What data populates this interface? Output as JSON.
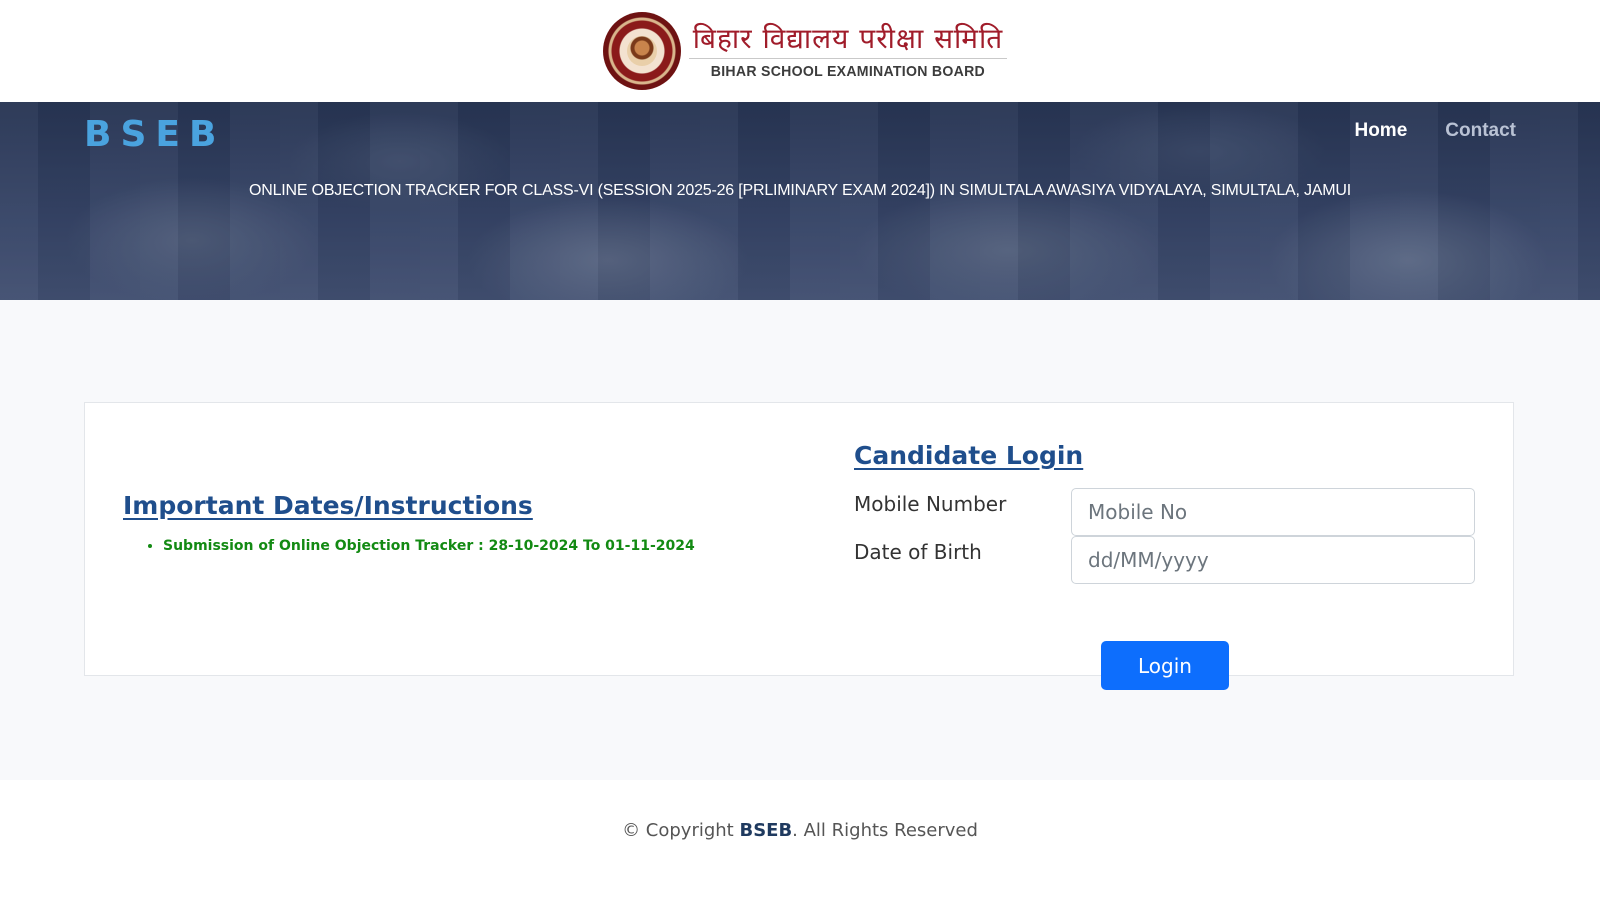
{
  "logo": {
    "hindi_name": "बिहार विद्यालय परीक्षा समिति",
    "english_name": "BIHAR SCHOOL EXAMINATION BOARD",
    "seal_icon": "bseb-seal-icon"
  },
  "header": {
    "brand": "BSEB",
    "nav": {
      "home": "Home",
      "contact": "Contact"
    },
    "title": "ONLINE OBJECTION TRACKER FOR CLASS-VI (SESSION 2025-26 [PRLIMINARY EXAM 2024]) IN SIMULTALA AWASIYA VIDYALAYA, SIMULTALA, JAMUI"
  },
  "instructions": {
    "title": "Important Dates/Instructions",
    "items": [
      "Submission of Online Objection Tracker : 28-10-2024 To 01-11-2024"
    ]
  },
  "login": {
    "title": "Candidate Login",
    "mobile_label": "Mobile Number",
    "mobile_placeholder": "Mobile No",
    "mobile_value": "",
    "dob_label": "Date of Birth",
    "dob_placeholder": "dd/MM/yyyy",
    "dob_value": "",
    "button_label": "Login"
  },
  "footer": {
    "prefix": "© Copyright ",
    "brand": "BSEB",
    "suffix": ". All Rights Reserved"
  },
  "colors": {
    "brand_blue": "#4aa3df",
    "heading_blue": "#1f4e8c",
    "instruction_green": "#138a13",
    "button_blue": "#0d6efd",
    "logo_red": "#a01c2a"
  }
}
